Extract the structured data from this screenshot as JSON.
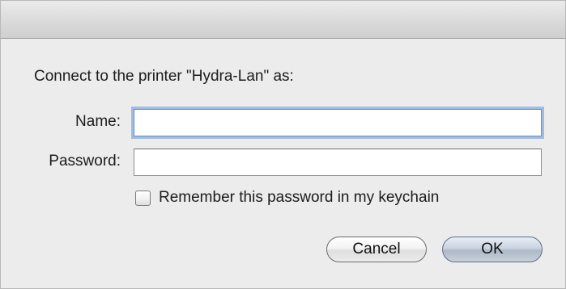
{
  "dialog": {
    "prompt": "Connect to the printer \"Hydra-Lan\" as:",
    "name_label": "Name:",
    "name_value": "",
    "password_label": "Password:",
    "password_value": "",
    "remember_label": "Remember this password in my keychain",
    "remember_checked": false,
    "cancel_label": "Cancel",
    "ok_label": "OK"
  },
  "colors": {
    "focus_ring": "#9ebde4",
    "window_background": "#ececec"
  }
}
